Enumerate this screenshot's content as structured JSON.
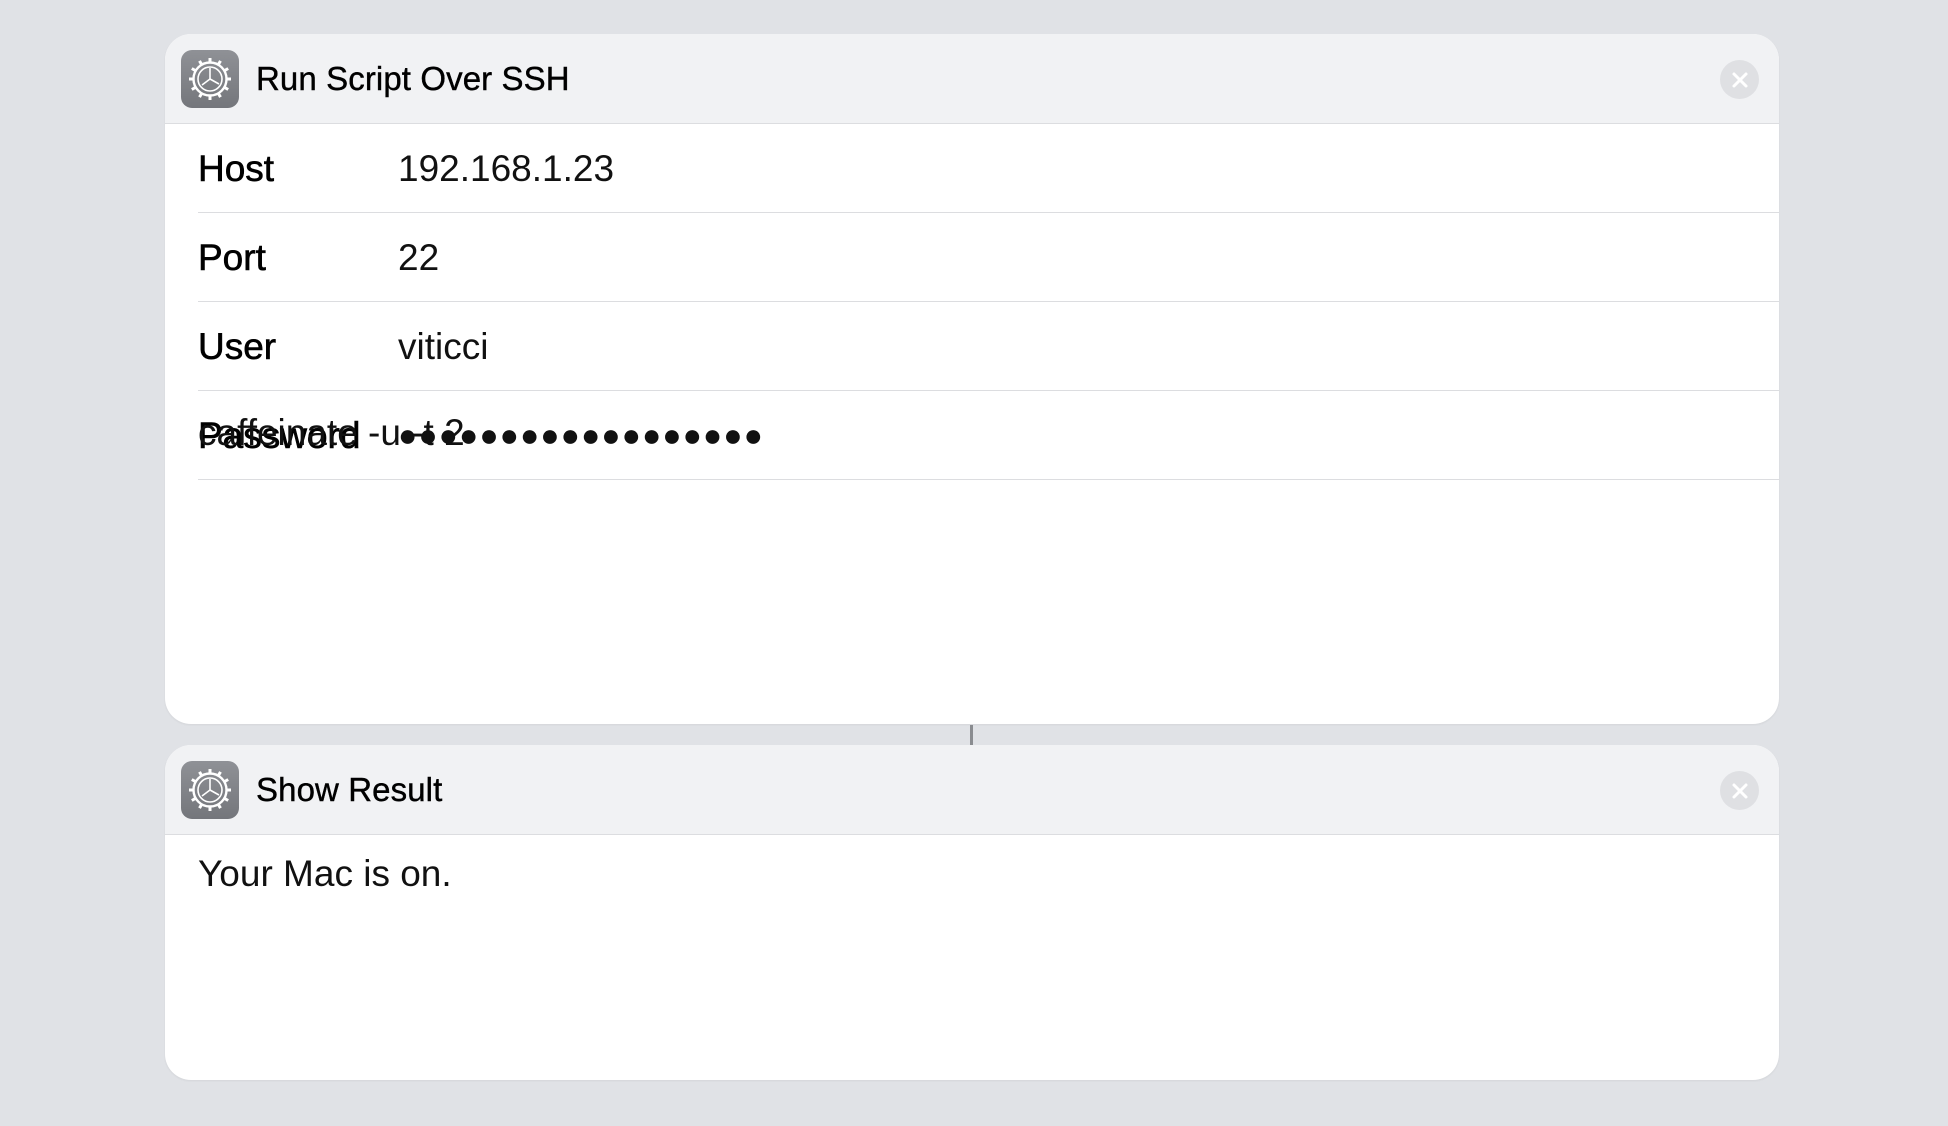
{
  "actions": {
    "ssh": {
      "title": "Run Script Over SSH",
      "icon": "gear-icon",
      "close_icon": "close-icon",
      "params": [
        {
          "label": "Host",
          "value": "192.168.1.23"
        },
        {
          "label": "Port",
          "value": "22"
        },
        {
          "label": "User",
          "value": "viticci"
        },
        {
          "label": "Password",
          "value": "●●●●●●●●●●●●●●●●●●"
        }
      ],
      "script": "caffeinate -u -t 2"
    },
    "result": {
      "title": "Show Result",
      "icon": "gear-icon",
      "close_icon": "close-icon",
      "text": "Your Mac is on."
    }
  },
  "colors": {
    "background": "#e0e2e6",
    "card": "#ffffff",
    "header": "#f1f2f4",
    "icon": "#7f8186"
  }
}
